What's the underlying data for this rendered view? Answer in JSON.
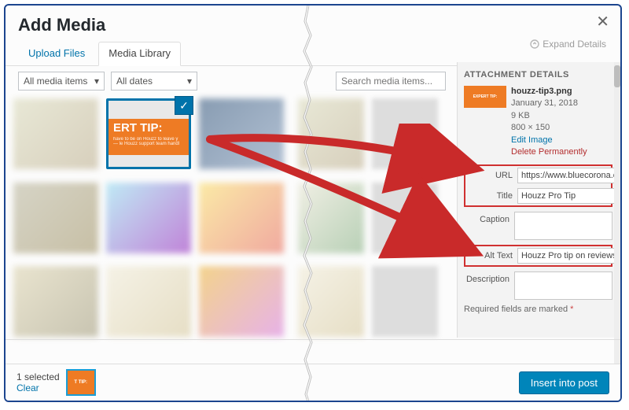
{
  "header": {
    "title": "Add Media"
  },
  "tabs": {
    "upload": "Upload Files",
    "library": "Media Library"
  },
  "filters": {
    "type_label": "All media items",
    "date_label": "All dates"
  },
  "search": {
    "placeholder": "Search media items..."
  },
  "expand": {
    "label": "Expand Details"
  },
  "selected_tile": {
    "headline": "ERT TIP:",
    "sub": "have to be on Houzz to leave y — le Houzz support team handl",
    "tiny_preview": "EXPERT TIP:"
  },
  "panel": {
    "heading": "ATTACHMENT DETAILS",
    "filename": "houzz-tip3.png",
    "date": "January 31, 2018",
    "filesize": "9 KB",
    "dimensions": "800 × 150",
    "edit_label": "Edit Image",
    "delete_label": "Delete Permanently"
  },
  "fields": {
    "url_label": "URL",
    "url_value": "https://www.bluecorona.com",
    "title_label": "Title",
    "title_value": "Houzz Pro Tip",
    "caption_label": "Caption",
    "caption_value": "",
    "alt_label": "Alt Text",
    "alt_value": "Houzz Pro tip on reviews",
    "desc_label": "Description",
    "desc_value": ""
  },
  "required_note": {
    "text": "Required fields are marked",
    "marker": "*"
  },
  "footer": {
    "selected_text": "1 selected",
    "clear_text": "Clear",
    "insert_label": "Insert into post",
    "mini_label": "T TIP:"
  }
}
